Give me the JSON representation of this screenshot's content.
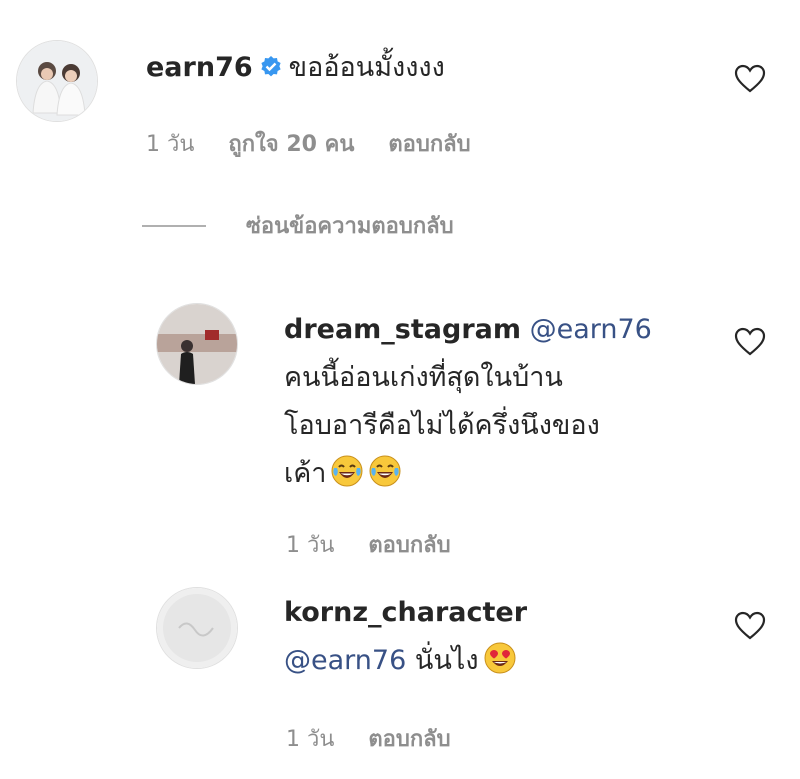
{
  "comments": [
    {
      "username": "earn76",
      "verified": true,
      "text": "ขออ้อนมั้งงงง",
      "time": "1 วัน",
      "likes": "ถูกใจ 20 คน",
      "reply_label": "ตอบกลับ"
    }
  ],
  "hide_replies_label": "ซ่อนข้อความตอบกลับ",
  "replies": [
    {
      "username": "dream_stagram",
      "mention": "@earn76",
      "lines": [
        "คนนี้อ่อนเก่งที่สุดในบ้าน",
        "โอบอารีคือไม่ได้ครึ่งนึงของ",
        "เค้า"
      ],
      "emoji": [
        "tears-of-joy-emoji",
        "tears-of-joy-emoji"
      ],
      "time": "1 วัน",
      "reply_label": "ตอบกลับ"
    },
    {
      "username": "kornz_character",
      "mention": "@earn76",
      "text": "นั่นไง",
      "emoji": [
        "heart-eyes-emoji"
      ],
      "time": "1 วัน",
      "reply_label": "ตอบกลับ"
    }
  ],
  "colors": {
    "text": "#262626",
    "meta": "#8e8e8e",
    "mention": "#385185",
    "verified": "#3897f0"
  }
}
